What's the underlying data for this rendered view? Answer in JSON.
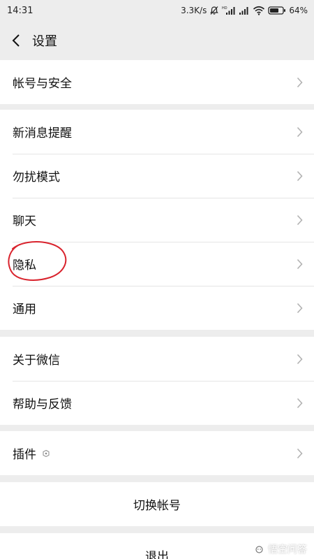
{
  "status_bar": {
    "time": "14:31",
    "speed": "3.3K/s",
    "battery": "64%"
  },
  "nav": {
    "title": "设置"
  },
  "groups": [
    {
      "items": [
        "帐号与安全"
      ]
    },
    {
      "items": [
        "新消息提醒",
        "勿扰模式",
        "聊天",
        "隐私",
        "通用"
      ]
    },
    {
      "items": [
        "关于微信",
        "帮助与反馈"
      ]
    },
    {
      "items": [
        "插件"
      ]
    }
  ],
  "actions": {
    "switch_account": "切换帐号",
    "logout": "退出"
  },
  "watermark": "悟空问答",
  "colors": {
    "background": "#ededed",
    "annotation": "#d9232d"
  }
}
